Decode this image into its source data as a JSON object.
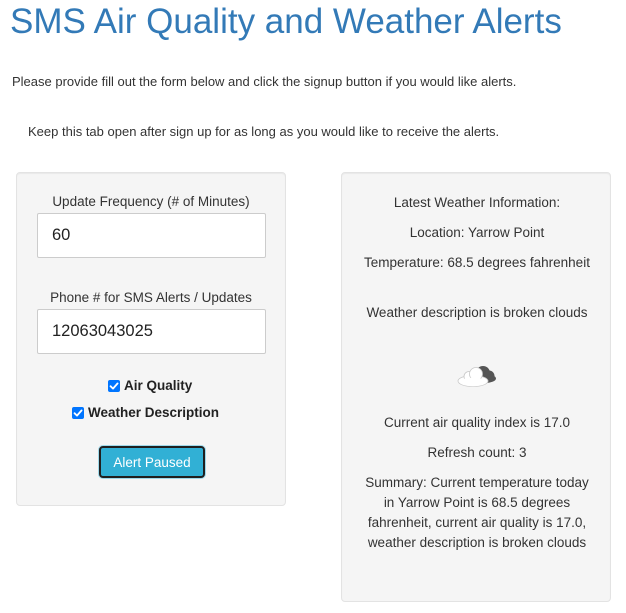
{
  "header": {
    "title": "SMS Air Quality and Weather Alerts"
  },
  "intro": {
    "instructions": "Please provide fill out the form below and click the signup button if you would like alerts.",
    "keep_open": "Keep this tab open after sign up for as long as you would like to receive the alerts."
  },
  "form": {
    "frequency_label": "Update Frequency (# of Minutes)",
    "frequency_value": "60",
    "phone_label": "Phone # for SMS Alerts / Updates",
    "phone_value": "12063043025",
    "air_quality_label": "Air Quality",
    "air_quality_checked": true,
    "weather_label": "Weather Description",
    "weather_checked": true,
    "button_label": "Alert Paused",
    "button_color": "#31b0d5"
  },
  "weather": {
    "heading": "Latest Weather Information:",
    "location": "Location: Yarrow Point",
    "temperature": "Temperature: 68.5 degrees fahrenheit",
    "description": "Weather description is broken clouds",
    "icon": "broken-clouds-icon",
    "air_quality": "Current air quality index is 17.0",
    "refresh": "Refresh count: 3",
    "summary": "Summary: Current temperature today in Yarrow Point is 68.5 degrees fahrenheit, current air quality is 17.0, weather description is broken clouds"
  },
  "colors": {
    "title": "#337ab7",
    "panel_bg": "#f5f5f5",
    "checkbox": "#0075ff"
  }
}
